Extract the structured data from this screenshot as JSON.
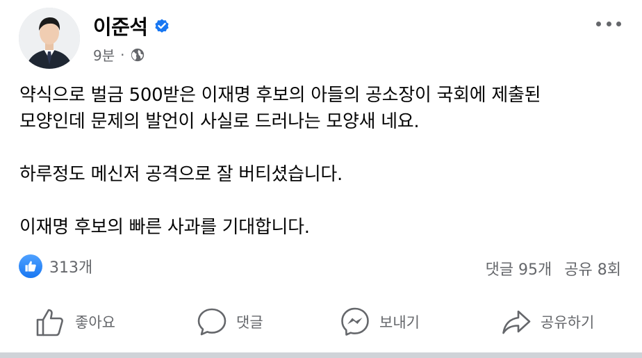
{
  "post": {
    "author": "이준석",
    "verified": true,
    "time": "9분",
    "separator": "·",
    "audience_icon": "globe-icon",
    "more_icon": "more-horizontal-icon",
    "body": [
      "약식으로 벌금 500받은 이재명 후보의 아들의 공소장이 국회에 제출된",
      "모양인데 문제의 발언이 사실로 드러나는 모양새 네요.",
      "",
      "하루정도 메신저 공격으로 잘 버티셨습니다.",
      "",
      "이재명 후보의 빠른 사과를 기대합니다."
    ]
  },
  "reactions": {
    "like_count": "313개",
    "comments": "댓글 95개",
    "shares": "공유 8회"
  },
  "actions": {
    "like": "좋아요",
    "comment": "댓글",
    "send": "보내기",
    "share": "공유하기"
  },
  "colors": {
    "accent": "#1877f2",
    "secondary_text": "#65676b",
    "primary_text": "#050505"
  }
}
